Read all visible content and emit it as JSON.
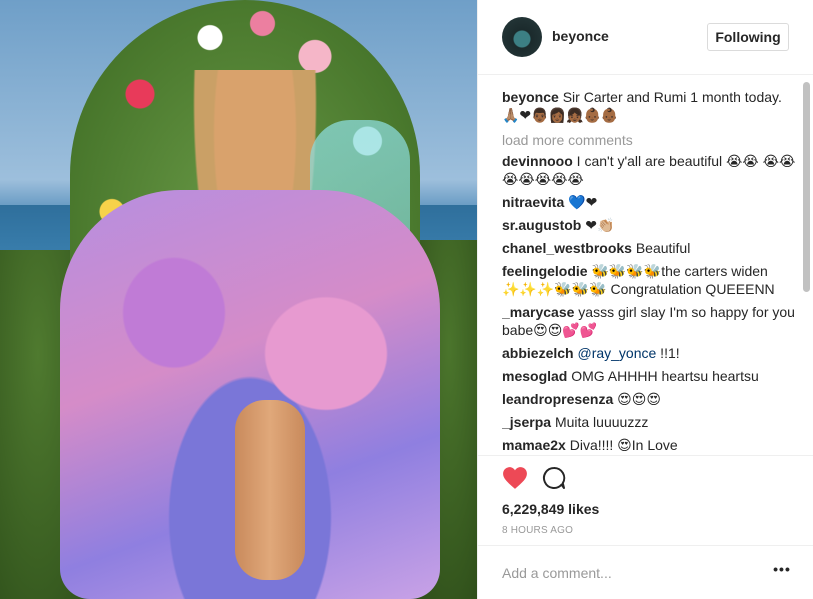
{
  "post": {
    "username": "beyonce",
    "follow_label": "Following",
    "caption": {
      "username": "beyonce",
      "text": "Sir Carter and Rumi 1 month today. 🙏🏽❤👨🏾👩🏾👧🏾👶🏾👶🏾"
    },
    "load_more_label": "load more comments",
    "comments": [
      {
        "username": "devinnooo",
        "text": "I can't y'all are beautiful 😭😭 😭😭😭😭😭😭😭"
      },
      {
        "username": "nitraevita",
        "text": "💙❤"
      },
      {
        "username": "sr.augustob",
        "text": "❤👏🏼"
      },
      {
        "username": "chanel_westbrooks",
        "text": "Beautiful"
      },
      {
        "username": "feelingelodie",
        "text": "🐝🐝🐝🐝the carters widen ✨✨✨🐝🐝🐝 Congratulation QUEEENN"
      },
      {
        "username": "_marycase",
        "text": "yasss girl slay I'm so happy for you babe😍😍💕💕"
      },
      {
        "username": "abbiezelch",
        "mention": "@ray_yonce",
        "text": " !!1!"
      },
      {
        "username": "mesoglad",
        "text": "OMG AHHHH heartsu heartsu"
      },
      {
        "username": "leandropresenza",
        "text": "😍😍😍"
      },
      {
        "username": "_jserpa",
        "text": "Muita luuuuzzz"
      },
      {
        "username": "mamae2x",
        "text": "Diva!!!! 😍In Love"
      }
    ],
    "likes": "6,229,849 likes",
    "time": "8 HOURS AGO",
    "add_comment_placeholder": "Add a comment...",
    "more_label": "•••"
  },
  "icons": {
    "heart": "heart-icon",
    "comment": "comment-icon",
    "avatar": "avatar"
  },
  "colors": {
    "heart": "#ed4956",
    "mention": "#003569",
    "muted": "#999999"
  }
}
